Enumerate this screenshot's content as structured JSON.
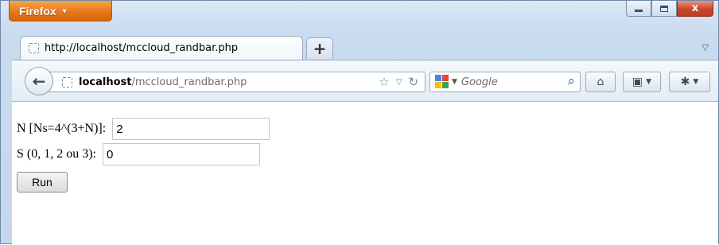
{
  "browser": {
    "app_button_label": "Firefox",
    "controls": {
      "minimize": "",
      "maximize": "",
      "close": "x"
    }
  },
  "tabs": [
    {
      "title": "http://localhost/mccloud_randbar.php"
    }
  ],
  "new_tab_label": "+",
  "tab_list_label": "▽",
  "navbar": {
    "url_host": "localhost",
    "url_path": "/mccloud_randbar.php",
    "search_engine": "Google",
    "search_placeholder": "Google"
  },
  "form": {
    "n_label": "N [Ns=4^(3+N)]: ",
    "n_value": "2",
    "s_label": "S (0, 1, 2 ou 3): ",
    "s_value": "0",
    "run_label": "Run"
  },
  "colors": {
    "firefox_orange": "#e8771a",
    "close_red": "#c9462b",
    "google_blue": "#4285f4",
    "google_red": "#ea4335",
    "google_yellow": "#fbbc05",
    "google_green": "#34a853"
  }
}
